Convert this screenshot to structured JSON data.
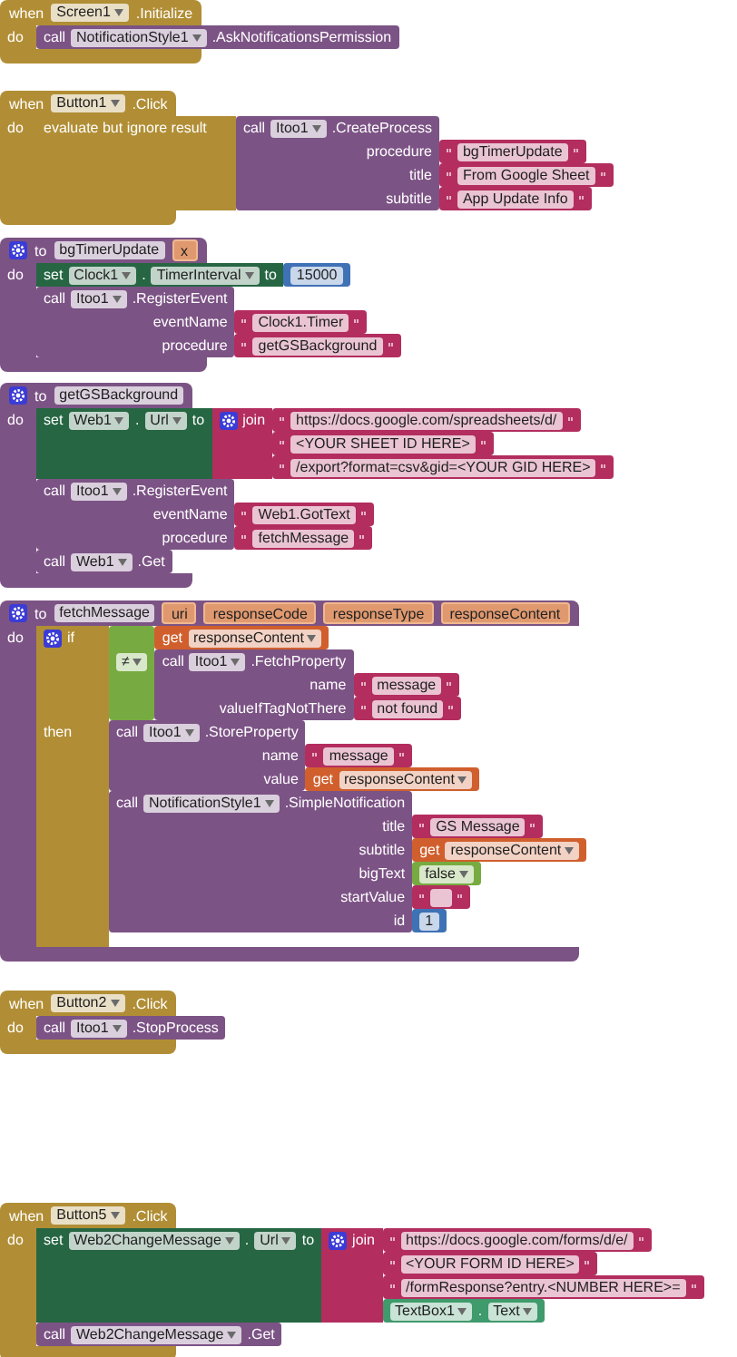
{
  "blocks": [
    {
      "kind": "event",
      "keyword": "when",
      "component": "Screen1",
      "event": ".Initialize",
      "do_label": "do",
      "body": [
        {
          "kind": "call",
          "keyword": "call",
          "component": "NotificationStyle1",
          "method": ".AskNotificationsPermission"
        }
      ]
    },
    {
      "kind": "event",
      "keyword": "when",
      "component": "Button1",
      "event": ".Click",
      "do_label": "do",
      "body": [
        {
          "kind": "evaluate",
          "label": "evaluate but ignore result",
          "value": {
            "kind": "call",
            "keyword": "call",
            "component": "Itoo1",
            "method": ".CreateProcess",
            "args": [
              {
                "name": "procedure",
                "value": {
                  "kind": "text",
                  "value": "bgTimerUpdate"
                }
              },
              {
                "name": "title",
                "value": {
                  "kind": "text",
                  "value": "From Google Sheet"
                }
              },
              {
                "name": "subtitle",
                "value": {
                  "kind": "text",
                  "value": "App Update Info"
                }
              }
            ]
          }
        }
      ]
    },
    {
      "kind": "procedure",
      "keyword": "to",
      "name": "bgTimerUpdate",
      "params": [
        "x"
      ],
      "do_label": "do",
      "body": [
        {
          "kind": "set",
          "keyword": "set",
          "component": "Clock1",
          "dot": ".",
          "property": "TimerInterval",
          "to": "to",
          "value": {
            "kind": "number",
            "value": "15000"
          }
        },
        {
          "kind": "call",
          "keyword": "call",
          "component": "Itoo1",
          "method": ".RegisterEvent",
          "args": [
            {
              "name": "eventName",
              "value": {
                "kind": "text",
                "value": "Clock1.Timer"
              }
            },
            {
              "name": "procedure",
              "value": {
                "kind": "text",
                "value": "getGSBackground"
              }
            }
          ]
        }
      ]
    },
    {
      "kind": "procedure",
      "keyword": "to",
      "name": "getGSBackground",
      "do_label": "do",
      "body": [
        {
          "kind": "set",
          "keyword": "set",
          "component": "Web1",
          "dot": ".",
          "property": "Url",
          "to": "to",
          "value": {
            "kind": "join",
            "keyword": "join",
            "items": [
              {
                "kind": "text",
                "value": "https://docs.google.com/spreadsheets/d/"
              },
              {
                "kind": "text",
                "value": "<YOUR SHEET ID HERE>"
              },
              {
                "kind": "text",
                "value": "/export?format=csv&gid=<YOUR GID HERE>"
              }
            ]
          }
        },
        {
          "kind": "call",
          "keyword": "call",
          "component": "Itoo1",
          "method": ".RegisterEvent",
          "args": [
            {
              "name": "eventName",
              "value": {
                "kind": "text",
                "value": "Web1.GotText"
              }
            },
            {
              "name": "procedure",
              "value": {
                "kind": "text",
                "value": "fetchMessage"
              }
            }
          ]
        },
        {
          "kind": "call",
          "keyword": "call",
          "component": "Web1",
          "method": ".Get"
        }
      ]
    },
    {
      "kind": "procedure",
      "keyword": "to",
      "name": "fetchMessage",
      "params": [
        "uri",
        "responseCode",
        "responseType",
        "responseContent"
      ],
      "do_label": "do",
      "body": [
        {
          "kind": "if",
          "keyword": "if",
          "then_label": "then",
          "condition": {
            "kind": "compare",
            "op": "≠",
            "a": {
              "kind": "get",
              "keyword": "get",
              "name": "responseContent"
            },
            "b": {
              "kind": "call",
              "keyword": "call",
              "component": "Itoo1",
              "method": ".FetchProperty",
              "args": [
                {
                  "name": "name",
                  "value": {
                    "kind": "text",
                    "value": "message"
                  }
                },
                {
                  "name": "valueIfTagNotThere",
                  "value": {
                    "kind": "text",
                    "value": "not found"
                  }
                }
              ]
            }
          },
          "then": [
            {
              "kind": "call",
              "keyword": "call",
              "component": "Itoo1",
              "method": ".StoreProperty",
              "args": [
                {
                  "name": "name",
                  "value": {
                    "kind": "text",
                    "value": "message"
                  }
                },
                {
                  "name": "value",
                  "value": {
                    "kind": "get",
                    "keyword": "get",
                    "name": "responseContent"
                  }
                }
              ]
            },
            {
              "kind": "call",
              "keyword": "call",
              "component": "NotificationStyle1",
              "method": ".SimpleNotification",
              "args": [
                {
                  "name": "title",
                  "value": {
                    "kind": "text",
                    "value": "GS Message"
                  }
                },
                {
                  "name": "subtitle",
                  "value": {
                    "kind": "get",
                    "keyword": "get",
                    "name": "responseContent"
                  }
                },
                {
                  "name": "bigText",
                  "value": {
                    "kind": "bool",
                    "value": "false"
                  }
                },
                {
                  "name": "startValue",
                  "value": {
                    "kind": "text"
                  }
                },
                {
                  "name": "id",
                  "value": {
                    "kind": "number",
                    "value": "1"
                  }
                }
              ]
            }
          ]
        }
      ]
    },
    {
      "kind": "event",
      "keyword": "when",
      "component": "Button2",
      "event": ".Click",
      "do_label": "do",
      "body": [
        {
          "kind": "call",
          "keyword": "call",
          "component": "Itoo1",
          "method": ".StopProcess"
        }
      ]
    },
    {
      "kind": "event",
      "keyword": "when",
      "component": "Button5",
      "event": ".Click",
      "do_label": "do",
      "body": [
        {
          "kind": "set",
          "keyword": "set",
          "component": "Web2ChangeMessage",
          "dot": ".",
          "property": "Url",
          "to": "to",
          "value": {
            "kind": "join",
            "keyword": "join",
            "items": [
              {
                "kind": "text",
                "value": "https://docs.google.com/forms/d/e/"
              },
              {
                "kind": "text",
                "value": "<YOUR FORM ID HERE>"
              },
              {
                "kind": "text",
                "value": "/formResponse?entry.<NUMBER HERE>="
              },
              {
                "kind": "property",
                "component": "TextBox1",
                "dot": ".",
                "property": "Text"
              }
            ]
          }
        },
        {
          "kind": "call",
          "keyword": "call",
          "component": "Web2ChangeMessage",
          "method": ".Get"
        }
      ]
    }
  ]
}
